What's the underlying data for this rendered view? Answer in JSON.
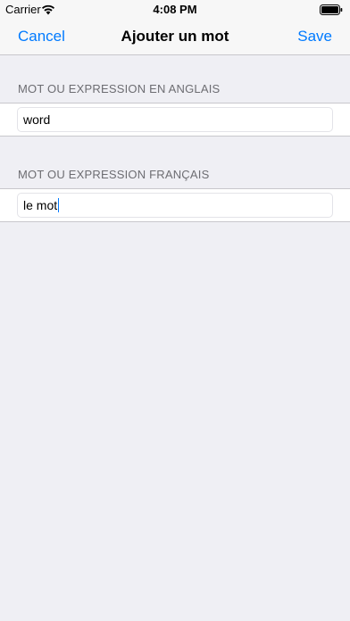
{
  "status_bar": {
    "carrier": "Carrier",
    "time": "4:08 PM",
    "wifi_icon": "wifi-icon",
    "battery_icon": "battery-icon"
  },
  "nav": {
    "cancel_label": "Cancel",
    "title": "Ajouter un mot",
    "save_label": "Save",
    "accent_color": "#007aff"
  },
  "form": {
    "english_section": {
      "header": "MOT OU EXPRESSION EN ANGLAIS",
      "value": "word"
    },
    "french_section": {
      "header": "MOT OU EXPRESSION FRANÇAIS",
      "value": "le mot"
    }
  }
}
